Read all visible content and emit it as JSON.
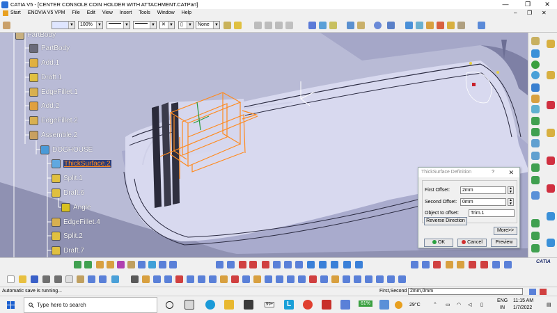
{
  "window": {
    "title": "CATIA V5 - [CENTER CONSOLE COIN HOLDER WITH ATTACHMENT.CATPart]",
    "minimize": "—",
    "restore": "❐",
    "close": "✕"
  },
  "menubar": {
    "items": [
      "Start",
      "ENOVIA V5 VPM",
      "File",
      "Edit",
      "View",
      "Insert",
      "Tools",
      "Window",
      "Help"
    ],
    "controls": [
      "–",
      "❐",
      "✕"
    ]
  },
  "toolbar": {
    "zoom": "100%",
    "line_weight": "None"
  },
  "tree": {
    "items": [
      {
        "label": "PartBody"
      },
      {
        "label": "PartBody"
      },
      {
        "label": "Add.1"
      },
      {
        "label": "Draft.1"
      },
      {
        "label": "EdgeFillet.1"
      },
      {
        "label": "Add.2"
      },
      {
        "label": "EdgeFillet.2"
      },
      {
        "label": "Assemble.2"
      },
      {
        "label": "DOGHOUSE"
      },
      {
        "label": "ThickSurface.2"
      },
      {
        "label": "Split.1"
      },
      {
        "label": "Draft.6"
      },
      {
        "label": "Angle"
      },
      {
        "label": "EdgeFillet.4"
      },
      {
        "label": "Split.2"
      },
      {
        "label": "Draft.7"
      }
    ]
  },
  "dialog": {
    "title": "ThickSurface Definition",
    "help": "?",
    "close": "✕",
    "first_offset_label": "First Offset:",
    "first_offset_value": "2mm",
    "second_offset_label": "Second Offset:",
    "second_offset_value": "0mm",
    "object_label": "Object to offset:",
    "object_value": "Trim.1",
    "reverse_button": "Reverse Direction",
    "more_button": "More>>",
    "ok_button": "OK",
    "cancel_button": "Cancel",
    "preview_button": "Preview"
  },
  "catia_logo": "CATIA",
  "status": {
    "message": "Automatic save is running...",
    "command_label": "First,Second",
    "command_value": "2mm,0mm"
  },
  "taskbar": {
    "search_placeholder": "Type here to search",
    "battery": "61%",
    "temperature": "29°C",
    "lang": "ENG",
    "region": "IN",
    "time": "11:15 AM",
    "date": "1/7/2022",
    "badge": "99+"
  },
  "colors": {
    "viewport_bg": "#b9bbd6",
    "selection": "#ff8a1e",
    "accent_blue": "#2a6fd6"
  }
}
